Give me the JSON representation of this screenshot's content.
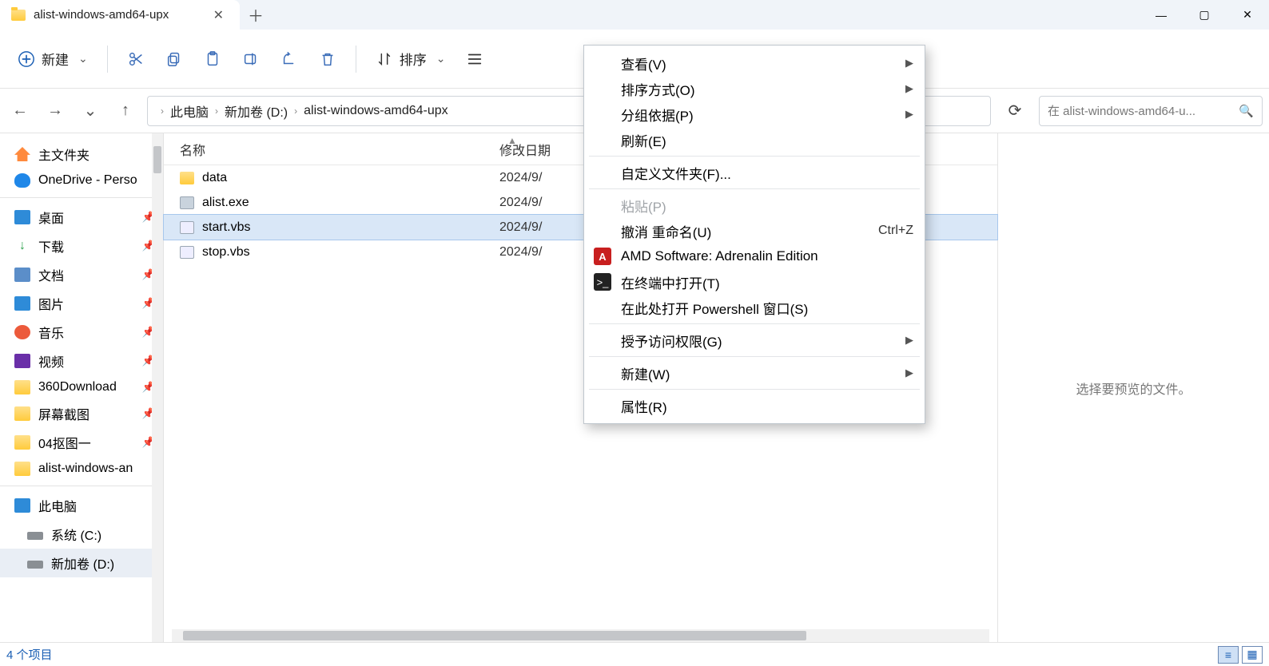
{
  "tab": {
    "title": "alist-windows-amd64-upx"
  },
  "toolbar": {
    "new_label": "新建",
    "sort_label": "排序"
  },
  "breadcrumb": {
    "root": "此电脑",
    "drive": "新加卷 (D:)",
    "folder": "alist-windows-amd64-upx"
  },
  "search": {
    "placeholder": "在 alist-windows-amd64-u..."
  },
  "sidebar": {
    "home": "主文件夹",
    "onedrive": "OneDrive - Perso",
    "quick": {
      "desktop": "桌面",
      "downloads": "下载",
      "documents": "文档",
      "pictures": "图片",
      "music": "音乐",
      "videos": "视频",
      "dl360": "360Download",
      "screenshots": "屏幕截图",
      "folder04": "04抠图一",
      "alist": "alist-windows-an"
    },
    "thispc": "此电脑",
    "drive_c": "系统 (C:)",
    "drive_d": "新加卷 (D:)"
  },
  "columns": {
    "name": "名称",
    "modified": "修改日期"
  },
  "files": [
    {
      "name": "data",
      "date": "2024/9/",
      "type": "folder"
    },
    {
      "name": "alist.exe",
      "date": "2024/9/",
      "type": "exe"
    },
    {
      "name": "start.vbs",
      "date": "2024/9/",
      "type": "vbs",
      "selected": true
    },
    {
      "name": "stop.vbs",
      "date": "2024/9/",
      "type": "vbs"
    }
  ],
  "preview": {
    "empty_text": "选择要预览的文件。"
  },
  "status": {
    "count_text": "4 个项目"
  },
  "context_menu": {
    "view": "查看(V)",
    "sort_by": "排序方式(O)",
    "group_by": "分组依据(P)",
    "refresh": "刷新(E)",
    "customize": "自定义文件夹(F)...",
    "paste": "粘贴(P)",
    "undo": "撤消 重命名(U)",
    "undo_shortcut": "Ctrl+Z",
    "amd": "AMD Software: Adrenalin Edition",
    "terminal": "在终端中打开(T)",
    "powershell": "在此处打开 Powershell 窗口(S)",
    "give_access": "授予访问权限(G)",
    "new": "新建(W)",
    "properties": "属性(R)"
  }
}
